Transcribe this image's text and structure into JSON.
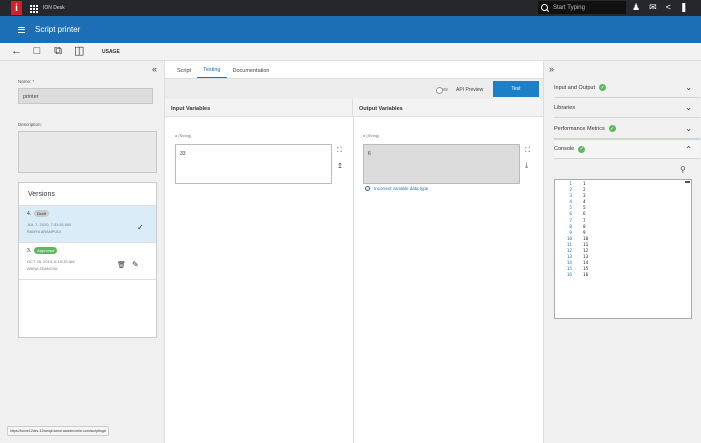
{
  "topbar": {
    "logo": "i",
    "app_name": "ION Desk",
    "search_placeholder": "Start Typing",
    "icons": [
      "user-icon",
      "mail-icon",
      "share-icon",
      "bookmark-icon"
    ]
  },
  "header": {
    "title": "Script printer"
  },
  "toolbar": {
    "usage_label": "USAGE",
    "icons": [
      "back-arrow-icon",
      "save-icon",
      "copy-icon",
      "export-icon"
    ]
  },
  "left": {
    "name_label": "Name:",
    "name_required": "*",
    "name_value": "printer",
    "description_label": "Description:",
    "versions_title": "Versions",
    "versions": [
      {
        "number": "4.",
        "status": "Draft",
        "date": "JUL 7, 2020, 7:31:51 AM",
        "user": "RAMYA ARAMPUDI"
      },
      {
        "number": "3.",
        "status": "Approved",
        "date": "OCT 25, 2019, 6:15:39 AM",
        "user": "ARINA ZDANOVA"
      }
    ],
    "status_url": "https://ionce12dev-12wmqk.ionce.awsdev.infor.com/scripting#"
  },
  "center": {
    "tabs": [
      {
        "label": "Script",
        "active": false
      },
      {
        "label": "Testing",
        "active": true
      },
      {
        "label": "Documentation",
        "active": false
      }
    ],
    "api_preview_label": "API Preview",
    "test_button": "Test",
    "input_header": "Input Variables",
    "output_header": "Output Variables",
    "input_var_label": "a (String)",
    "input_var_value": "33",
    "output_var_label": "b (String)",
    "output_var_value": "6",
    "error_text": "Incorrect variable data type"
  },
  "right": {
    "sections": [
      {
        "label": "Input and Output",
        "checked": true,
        "open": false
      },
      {
        "label": "Libraries",
        "checked": false,
        "open": false
      },
      {
        "label": "Performance Metrics",
        "checked": true,
        "open": false
      },
      {
        "label": "Console",
        "checked": true,
        "open": true
      }
    ],
    "console_lines": [
      {
        "n": "1",
        "t": "1"
      },
      {
        "n": "2",
        "t": "2"
      },
      {
        "n": "3",
        "t": "3"
      },
      {
        "n": "4",
        "t": "4"
      },
      {
        "n": "5",
        "t": "5"
      },
      {
        "n": "6",
        "t": "6"
      },
      {
        "n": "7",
        "t": "7"
      },
      {
        "n": "8",
        "t": "8"
      },
      {
        "n": "9",
        "t": "9"
      },
      {
        "n": "10",
        "t": "10"
      },
      {
        "n": "11",
        "t": "11"
      },
      {
        "n": "12",
        "t": "12"
      },
      {
        "n": "13",
        "t": "13"
      },
      {
        "n": "14",
        "t": "14"
      },
      {
        "n": "15",
        "t": "15"
      },
      {
        "n": "16",
        "t": "16"
      }
    ]
  },
  "colors": {
    "brand_red": "#d31f26",
    "header_blue": "#1d6fb5",
    "button_blue": "#1d80c6",
    "success_green": "#5bb85d"
  }
}
